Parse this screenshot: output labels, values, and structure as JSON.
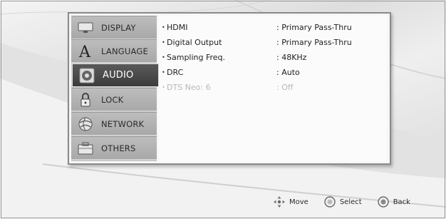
{
  "sidebar": {
    "items": [
      {
        "label": "DISPLAY",
        "icon": "display-icon"
      },
      {
        "label": "LANGUAGE",
        "icon": "language-icon"
      },
      {
        "label": "AUDIO",
        "icon": "audio-icon",
        "active": true
      },
      {
        "label": "LOCK",
        "icon": "lock-icon"
      },
      {
        "label": "NETWORK",
        "icon": "network-icon"
      },
      {
        "label": "OTHERS",
        "icon": "others-icon"
      }
    ]
  },
  "settings": {
    "rows": [
      {
        "name": "HDMI",
        "value": ": Primary Pass-Thru"
      },
      {
        "name": "Digital Output",
        "value": ": Primary Pass-Thru"
      },
      {
        "name": "Sampling Freq.",
        "value": ": 48KHz"
      },
      {
        "name": "DRC",
        "value": ": Auto"
      },
      {
        "name": "DTS Neo: 6",
        "value": ": Off",
        "disabled": true
      }
    ]
  },
  "footer": {
    "move": "Move",
    "select": "Select",
    "back": "Back"
  },
  "colors": {
    "active_tab": "#444444",
    "panel_border": "#8a8a8a",
    "disabled_text": "#b8b8b8"
  }
}
